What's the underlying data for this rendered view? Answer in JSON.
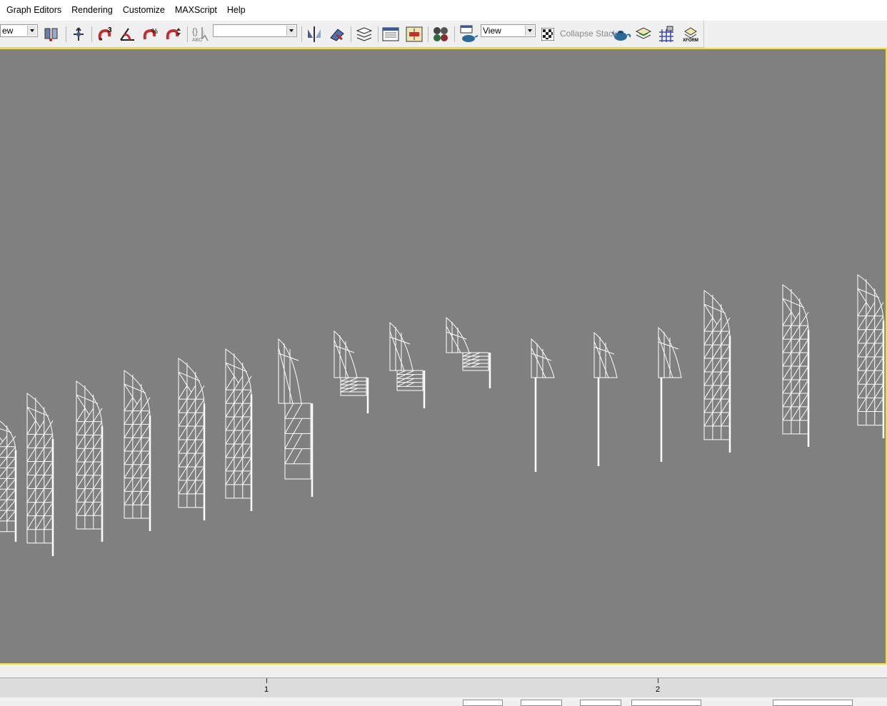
{
  "menu": {
    "items": [
      "Graph Editors",
      "Rendering",
      "Customize",
      "MAXScript",
      "Help"
    ]
  },
  "toolbar": {
    "view_dropdown_left": "ew",
    "named_selection_value": "",
    "reference_coord_value": "View",
    "collapse_stack_label": "Collapse Stack",
    "xform_label": "XFORM",
    "icons": [
      "select-filter-icon",
      "select-move-icon",
      "snap-3d-icon",
      "angle-snap-icon",
      "percent-snap-icon",
      "spinner-snap-icon",
      "edit-named-selection-icon",
      "mirror-icon",
      "align-icon",
      "layers-icon",
      "curve-editor-icon",
      "schematic-view-icon",
      "material-editor-icon",
      "render-setup-icon",
      "checker-icon",
      "render-teapot-icon",
      "layer-stack-icon",
      "grid-icon",
      "xform-icon"
    ]
  },
  "viewport": {
    "border_color": "#f2e31c",
    "background": "#808080"
  },
  "timeline": {
    "tick_labels": [
      "1",
      "2"
    ]
  }
}
